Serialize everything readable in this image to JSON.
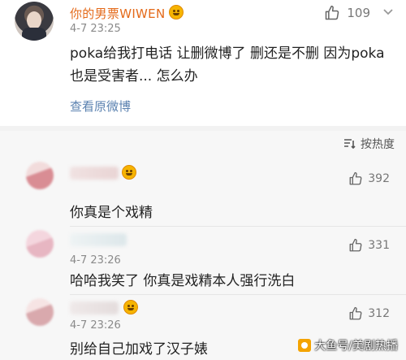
{
  "post": {
    "username": "你的男票WIWEN",
    "time": "4-7 23:25",
    "like_count": "109",
    "body": "poka给我打电话 让删微博了 删还是不删 因为poka也是受害者... 怎么办",
    "view_original": "查看原微博"
  },
  "sort": {
    "label": "按热度"
  },
  "comments": [
    {
      "time": "",
      "text": "你真是个戏精",
      "likes": "392"
    },
    {
      "time": "4-7 23:26",
      "text": "哈哈我笑了 你真是戏精本人强行洗白",
      "likes": "331"
    },
    {
      "time": "4-7 23:26",
      "text": "别给自己加戏了汉子婊",
      "likes": "312"
    }
  ],
  "watermark": "大鱼号/美剧热播",
  "icons": {
    "like": "thumbs-up-icon",
    "expand": "chevron-down-icon",
    "sort": "sort-lines-icon"
  },
  "colors": {
    "username": "#e46a1a",
    "link": "#5b82b0",
    "comments_bg": "#f7f7f7"
  }
}
